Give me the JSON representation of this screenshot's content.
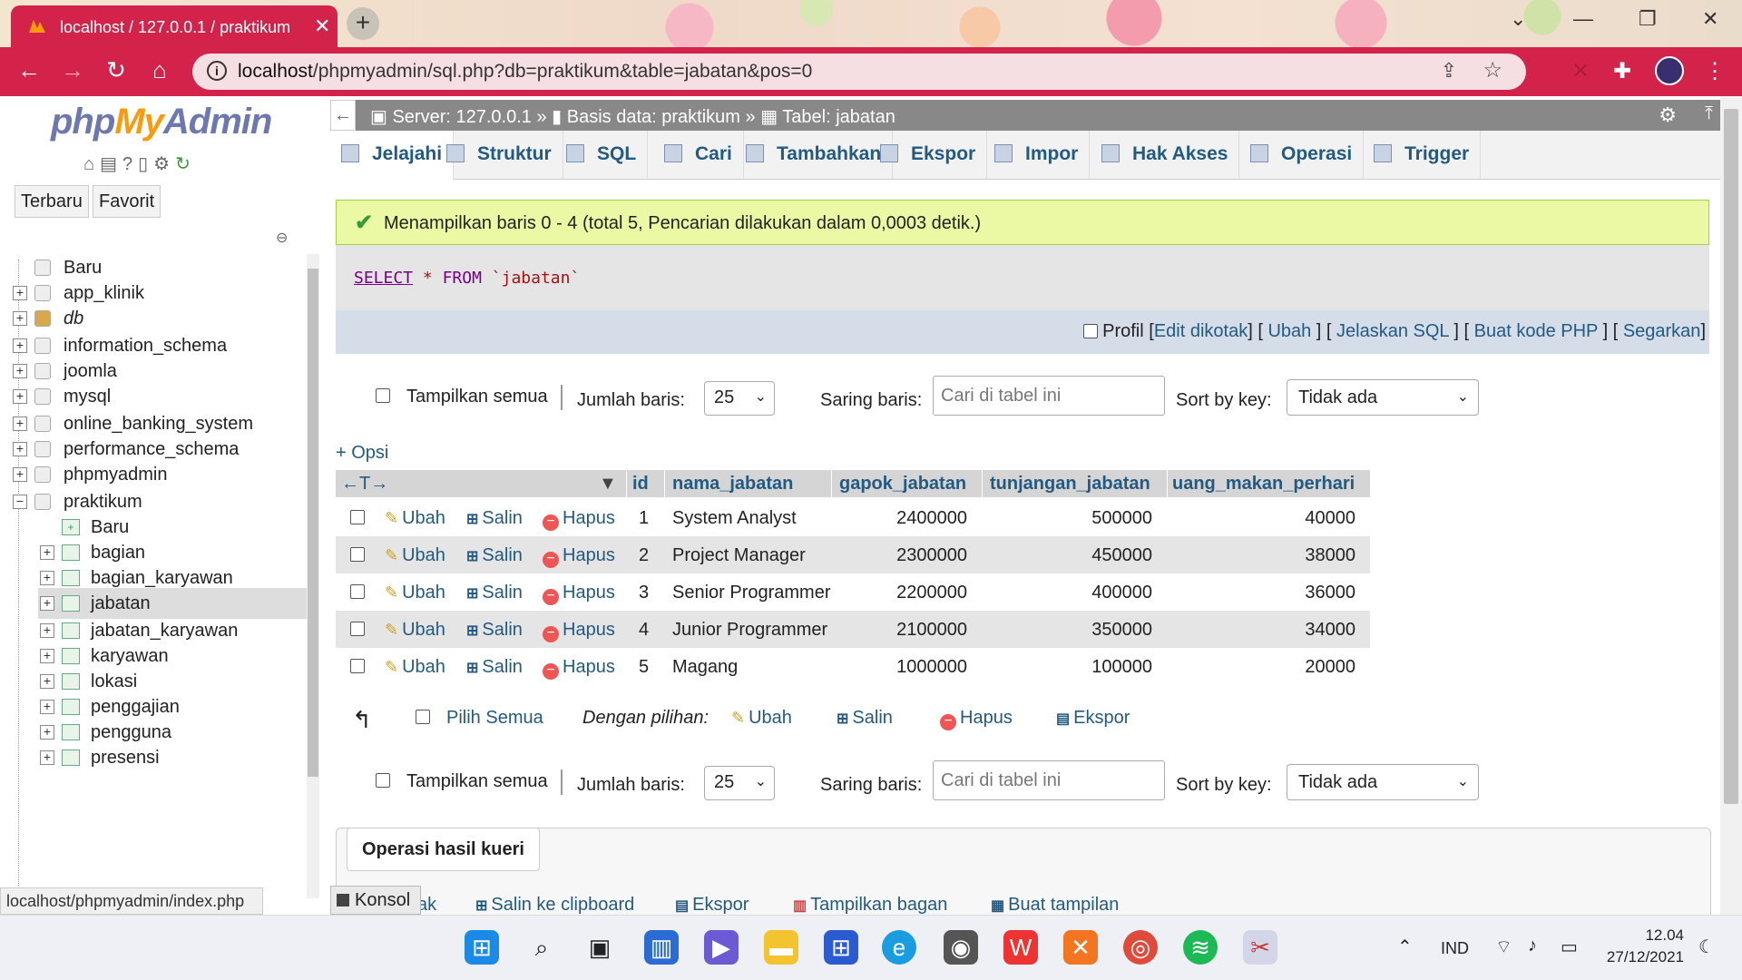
{
  "browser": {
    "tab_title": "localhost / 127.0.0.1 / praktikum",
    "tab_close": "✕",
    "new_tab": "+",
    "url_host": "localhost",
    "url_path": "/phpmyadmin/sql.php?db=praktikum&table=jabatan&pos=0",
    "status_url": "localhost/phpmyadmin/index.php"
  },
  "left": {
    "logo_php": "php",
    "logo_my": "My",
    "logo_admin": "Admin",
    "tab_recent": "Terbaru",
    "tab_fav": "Favorit",
    "tree": [
      {
        "label": "Baru",
        "level": 0,
        "expander": "",
        "italic": false
      },
      {
        "label": "app_klinik",
        "level": 0,
        "expander": "+",
        "italic": false
      },
      {
        "label": "db",
        "level": 0,
        "expander": "+",
        "italic": true
      },
      {
        "label": "information_schema",
        "level": 0,
        "expander": "+",
        "italic": false
      },
      {
        "label": "joomla",
        "level": 0,
        "expander": "+",
        "italic": false
      },
      {
        "label": "mysql",
        "level": 0,
        "expander": "+",
        "italic": false
      },
      {
        "label": "online_banking_system",
        "level": 0,
        "expander": "+",
        "italic": false
      },
      {
        "label": "performance_schema",
        "level": 0,
        "expander": "+",
        "italic": false
      },
      {
        "label": "phpmyadmin",
        "level": 0,
        "expander": "+",
        "italic": false
      },
      {
        "label": "praktikum",
        "level": 0,
        "expander": "−",
        "italic": false
      },
      {
        "label": "Baru",
        "level": 1,
        "expander": "",
        "italic": false
      },
      {
        "label": "bagian",
        "level": 1,
        "expander": "+",
        "italic": false
      },
      {
        "label": "bagian_karyawan",
        "level": 1,
        "expander": "+",
        "italic": false
      },
      {
        "label": "jabatan",
        "level": 1,
        "expander": "+",
        "italic": false,
        "selected": true
      },
      {
        "label": "jabatan_karyawan",
        "level": 1,
        "expander": "+",
        "italic": false
      },
      {
        "label": "karyawan",
        "level": 1,
        "expander": "+",
        "italic": false
      },
      {
        "label": "lokasi",
        "level": 1,
        "expander": "+",
        "italic": false
      },
      {
        "label": "penggajian",
        "level": 1,
        "expander": "+",
        "italic": false
      },
      {
        "label": "pengguna",
        "level": 1,
        "expander": "+",
        "italic": false
      },
      {
        "label": "presensi",
        "level": 1,
        "expander": "+",
        "italic": false
      }
    ]
  },
  "breadcrumb": {
    "server": "Server: 127.0.0.1",
    "db": "Basis data: praktikum",
    "table": "Tabel: jabatan",
    "sep": "»"
  },
  "tabs": [
    "Jelajahi",
    "Struktur",
    "SQL",
    "Cari",
    "Tambahkan",
    "Ekspor",
    "Impor",
    "Hak Akses",
    "Operasi",
    "Trigger"
  ],
  "success_msg": "Menampilkan baris 0 - 4 (total 5, Pencarian dilakukan dalam 0,0003 detik.)",
  "sql": {
    "select": "SELECT",
    "star": "*",
    "from": "FROM",
    "table": "`jabatan`"
  },
  "sql_opts": {
    "profil": "Profil",
    "links": [
      "Edit dikotak",
      "Ubah",
      "Jelaskan SQL",
      "Buat kode PHP",
      "Segarkan"
    ]
  },
  "nav": {
    "show_all": "Tampilkan semua",
    "rows_label": "Jumlah baris:",
    "rows_value": "25",
    "filter_label": "Saring baris:",
    "filter_placeholder": "Cari di tabel ini",
    "sort_label": "Sort by key:",
    "sort_value": "Tidak ada"
  },
  "opsi": "+ Opsi",
  "grid": {
    "arrows": "←T→",
    "columns": [
      "id",
      "nama_jabatan",
      "gapok_jabatan",
      "tunjangan_jabatan",
      "uang_makan_perhari"
    ],
    "actions": [
      "Ubah",
      "Salin",
      "Hapus"
    ],
    "rows": [
      [
        "1",
        "System Analyst",
        "2400000",
        "500000",
        "40000"
      ],
      [
        "2",
        "Project Manager",
        "2300000",
        "450000",
        "38000"
      ],
      [
        "3",
        "Senior Programmer",
        "2200000",
        "400000",
        "36000"
      ],
      [
        "4",
        "Junior Programmer",
        "2100000",
        "350000",
        "34000"
      ],
      [
        "5",
        "Magang",
        "1000000",
        "100000",
        "20000"
      ]
    ]
  },
  "bulk": {
    "select_all": "Pilih Semua",
    "with_selected": "Dengan pilihan:",
    "edit": "Ubah",
    "copy": "Salin",
    "delete": "Hapus",
    "export": "Ekspor"
  },
  "query_ops": {
    "title": "Operasi hasil kueri",
    "konsol": "Konsol",
    "print_frag": "ak",
    "copy_clip": "Salin ke clipboard",
    "export": "Ekspor",
    "chart": "Tampilkan bagan",
    "view": "Buat tampilan"
  },
  "taskbar": {
    "lang": "IND",
    "time": "12.04",
    "date": "27/12/2021"
  }
}
